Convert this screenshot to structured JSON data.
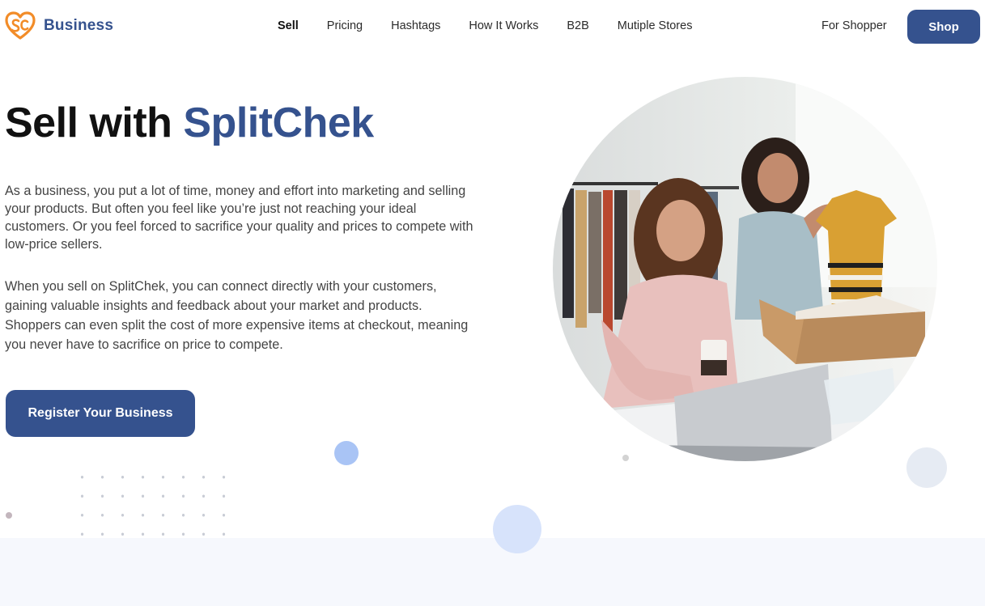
{
  "header": {
    "brand": "Business",
    "nav": [
      {
        "label": "Sell",
        "active": true
      },
      {
        "label": "Pricing",
        "active": false
      },
      {
        "label": "Hashtags",
        "active": false
      },
      {
        "label": "How It Works",
        "active": false
      },
      {
        "label": "B2B",
        "active": false
      },
      {
        "label": "Mutiple Stores",
        "active": false
      }
    ],
    "for_shopper": "For Shopper",
    "shop_label": "Shop"
  },
  "hero": {
    "title_prefix": "Sell with ",
    "title_accent": "SplitChek",
    "paragraph1": "As a business, you put a lot of time, money and effort into marketing and selling your products. But often you feel like you’re just not reaching your ideal customers. Or you feel forced to sacrifice your quality and prices to compete with low-price sellers.",
    "paragraph2": "When you sell on SplitChek, you can connect directly with your customers, gaining valuable insights and feedback about your market and products. Shoppers can even split the cost of more expensive items at checkout, meaning you never have to sacrifice on price to compete.",
    "cta_label": "Register Your Business"
  },
  "colors": {
    "brand_blue": "#35528e",
    "logo_orange": "#f28c28",
    "accent_light_blue": "#a9c4f5",
    "background_band": "#f6f8fd"
  }
}
